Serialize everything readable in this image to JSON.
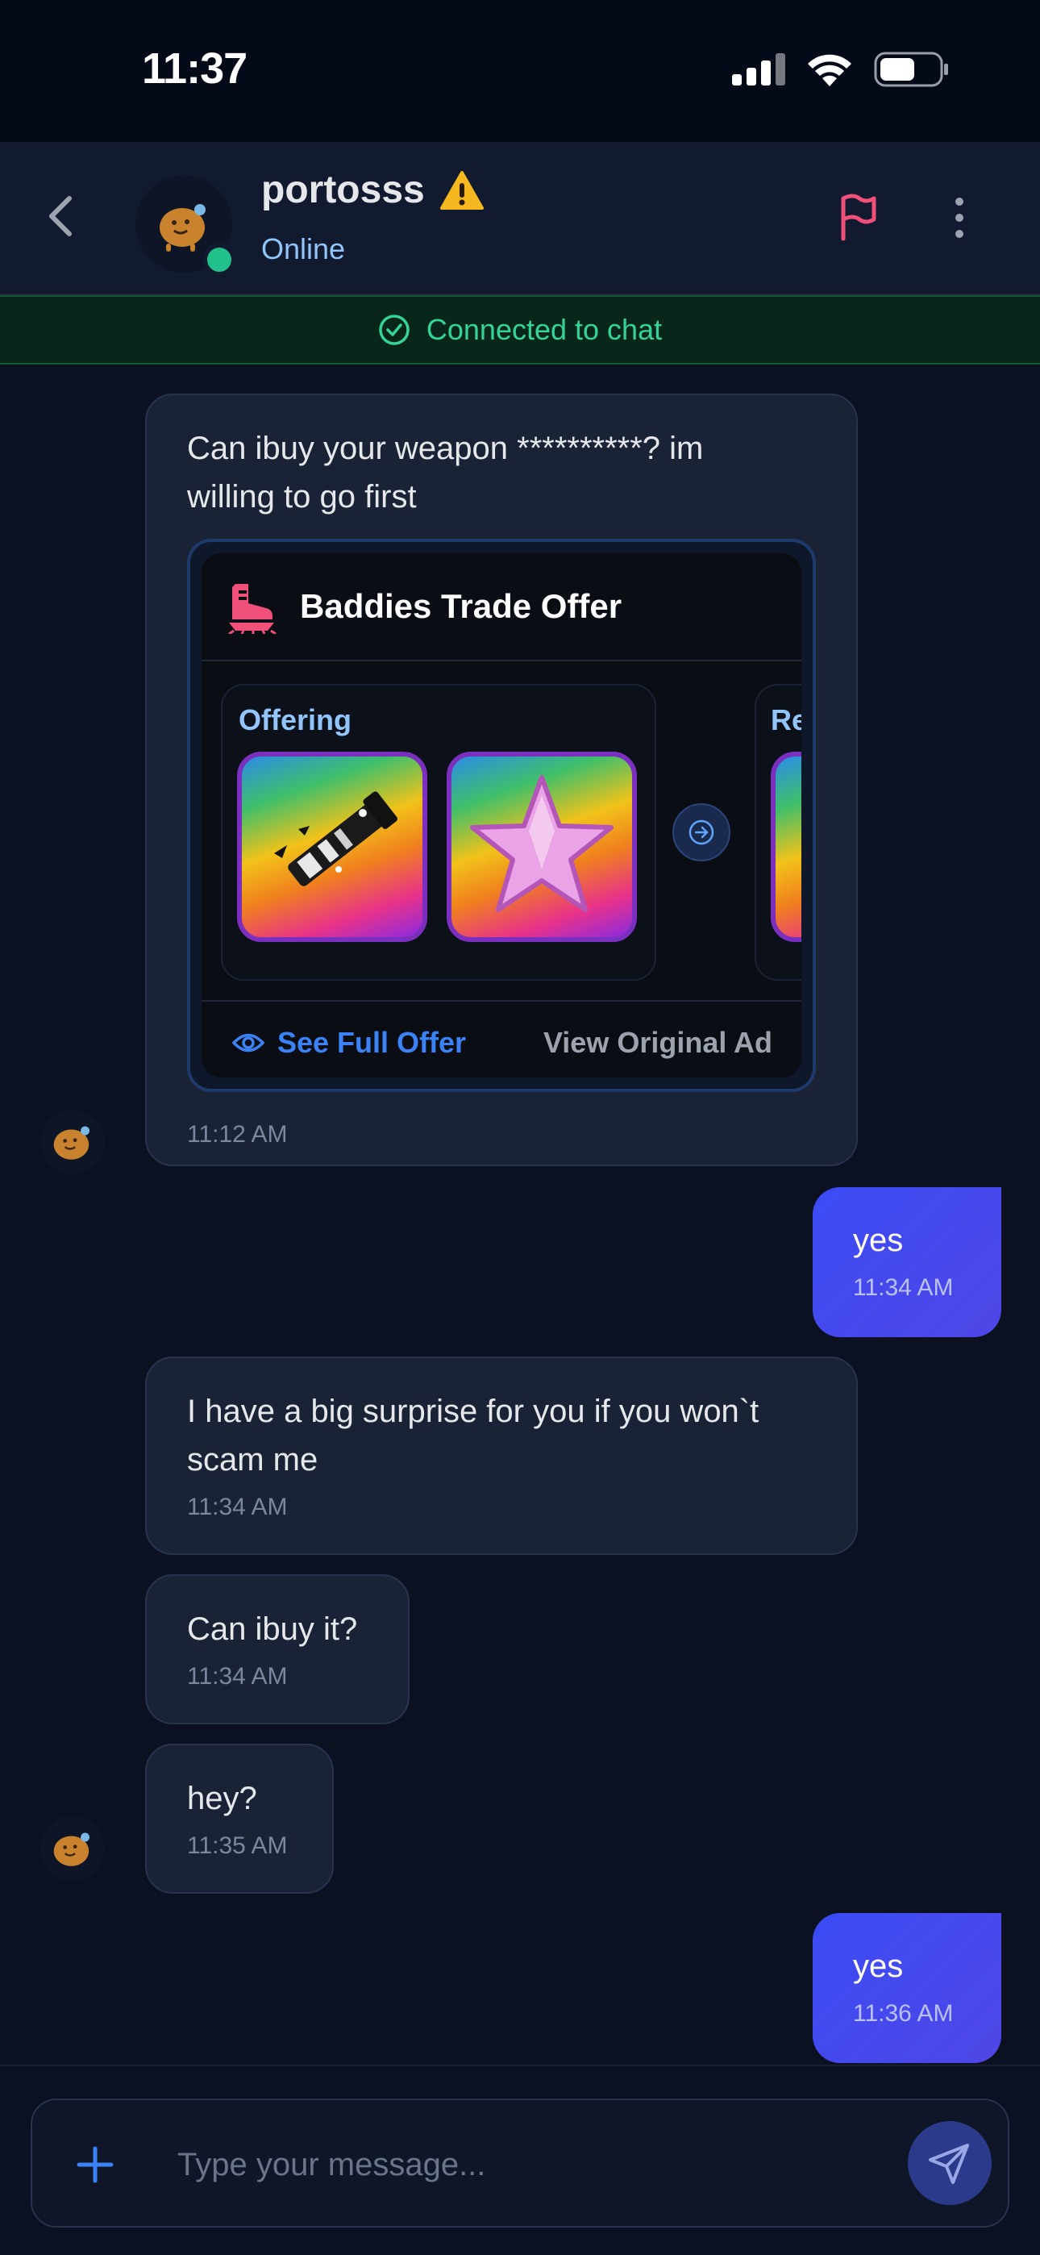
{
  "status_bar": {
    "time": "11:37"
  },
  "header": {
    "username": "portosss",
    "status": "Online"
  },
  "banner": {
    "text": "Connected to chat"
  },
  "messages": [
    {
      "text": "Can ibuy your weapon **********? im willing to go first",
      "time": "11:12 AM"
    },
    {
      "text": "yes",
      "time": "11:34 AM"
    },
    {
      "text": "I have a big surprise for you if you won`t scam me",
      "time": "11:34 AM"
    },
    {
      "text": "Can ibuy it?",
      "time": "11:34 AM"
    },
    {
      "text": "hey?",
      "time": "11:35 AM"
    },
    {
      "text": "yes",
      "time": "11:36 AM"
    }
  ],
  "trade": {
    "title": "Baddies Trade Offer",
    "offering_label": "Offering",
    "request_label": "Re",
    "see_full": "See Full Offer",
    "view_ad": "View Original Ad"
  },
  "composer": {
    "placeholder": "Type your message..."
  }
}
